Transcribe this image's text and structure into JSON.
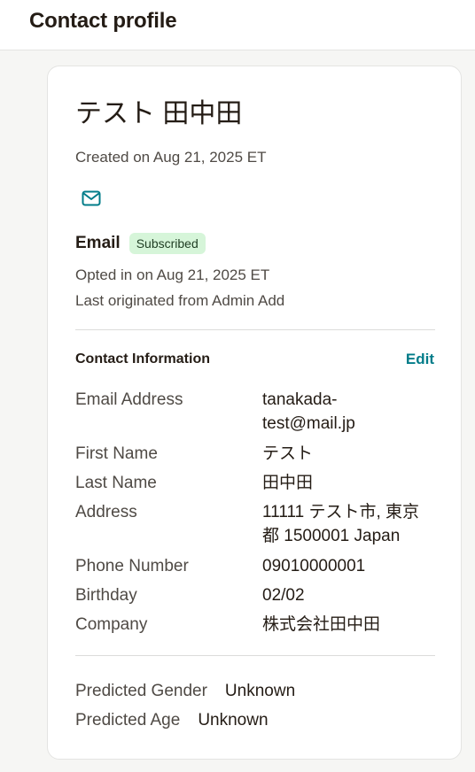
{
  "header": {
    "title": "Contact profile"
  },
  "contact": {
    "name": "テスト 田中田",
    "created": "Created on Aug 21, 2025 ET",
    "icon": "mail-icon",
    "email_heading": "Email",
    "status_badge": "Subscribed",
    "opted_in": "Opted in on Aug 21, 2025 ET",
    "origin": "Last originated from Admin Add"
  },
  "contact_info": {
    "title": "Contact Information",
    "edit_label": "Edit",
    "fields": [
      {
        "label": "Email Address",
        "value": "tanakada-test@mail.jp"
      },
      {
        "label": "First Name",
        "value": "テスト"
      },
      {
        "label": "Last Name",
        "value": "田中田"
      },
      {
        "label": "Address",
        "value": "11111 テスト市, 東京都 1500001 Japan"
      },
      {
        "label": "Phone Number",
        "value": "09010000001"
      },
      {
        "label": "Birthday",
        "value": "02/02"
      },
      {
        "label": "Company",
        "value": "株式会社田中田"
      }
    ]
  },
  "predictions": [
    {
      "label": "Predicted Gender",
      "value": "Unknown"
    },
    {
      "label": "Predicted Age",
      "value": "Unknown"
    }
  ],
  "colors": {
    "accent": "#007c89",
    "badge_bg": "#d6f5d9",
    "text": "#241c15",
    "muted": "#4f4a45"
  }
}
